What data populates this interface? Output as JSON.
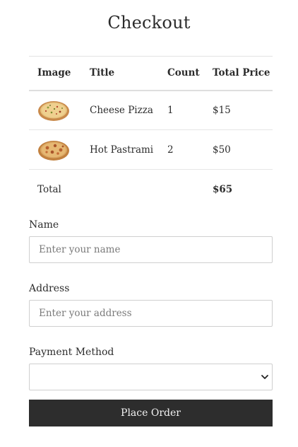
{
  "page": {
    "title": "Checkout"
  },
  "table": {
    "headers": {
      "image": "Image",
      "title": "Title",
      "count": "Count",
      "total_price": "Total Price"
    },
    "rows": [
      {
        "image_icon": "cheese-pizza-image",
        "title": "Cheese Pizza",
        "count": "1",
        "price": "$15"
      },
      {
        "image_icon": "hot-pastrami-pizza-image",
        "title": "Hot Pastrami",
        "count": "2",
        "price": "$50"
      }
    ],
    "total": {
      "label": "Total",
      "amount": "$65"
    }
  },
  "form": {
    "name": {
      "label": "Name",
      "placeholder": "Enter your name",
      "value": ""
    },
    "address": {
      "label": "Address",
      "placeholder": "Enter your address",
      "value": ""
    },
    "payment_method": {
      "label": "Payment Method",
      "selected": ""
    }
  },
  "actions": {
    "place_order_label": "Place Order"
  },
  "colors": {
    "button_background": "#2d2d2d",
    "button_text": "#f2f2f2",
    "border": "#cfcfcf",
    "text": "#2d2d2d"
  }
}
